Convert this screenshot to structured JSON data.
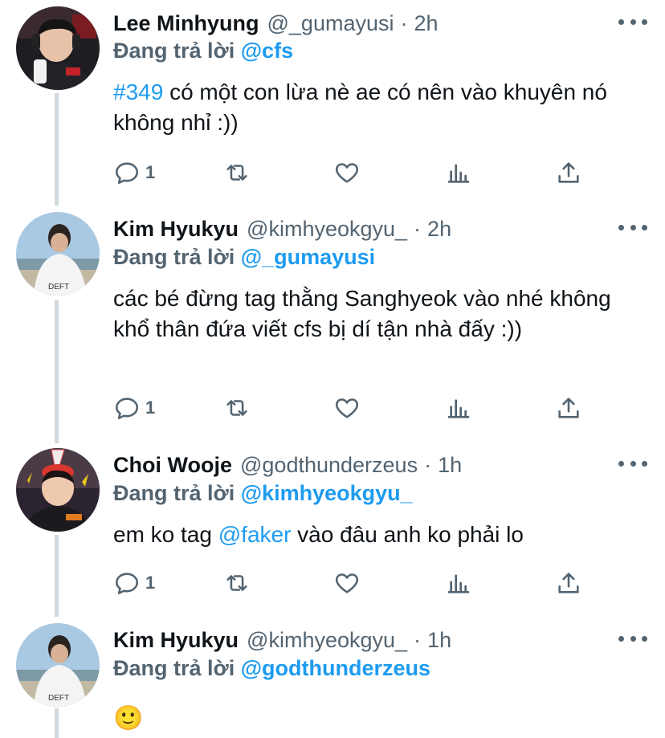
{
  "colors": {
    "accent": "#1d9bf0",
    "muted": "#536471",
    "text": "#0f1419",
    "thread_line": "#cfd9de"
  },
  "reply_prefix": "Đang trả lời",
  "tweets": [
    {
      "name": "Lee Minhyung",
      "handle": "@_gumayusi",
      "time": "2h",
      "reply_to": "@cfs",
      "text_link": "#349",
      "text": " có một con lừa nè ae có nên vào khuyên nó không nhỉ :))",
      "reply_count": "1",
      "avatar": "avatar-lee-minhyung"
    },
    {
      "name": "Kim Hyukyu",
      "handle": "@kimhyeokgyu_",
      "time": "2h",
      "reply_to": "@_gumayusi",
      "text": "các bé đừng tag thằng Sanghyeok vào nhé không khổ thân đứa viết cfs bị dí tận nhà đấy :))",
      "reply_count": "1",
      "avatar": "avatar-kim-hyukyu"
    },
    {
      "name": "Choi Wooje",
      "handle": "@godthunderzeus",
      "time": "1h",
      "reply_to": "@kimhyeokgyu_",
      "text_pre": "em ko tag ",
      "text_link": "@faker",
      "text_post": " vào đâu anh ko phải lo",
      "reply_count": "1",
      "avatar": "avatar-choi-wooje"
    },
    {
      "name": "Kim Hyukyu",
      "handle": "@kimhyeokgyu_",
      "time": "1h",
      "reply_to": "@godthunderzeus",
      "emoji": "🙂",
      "avatar": "avatar-kim-hyukyu"
    }
  ]
}
